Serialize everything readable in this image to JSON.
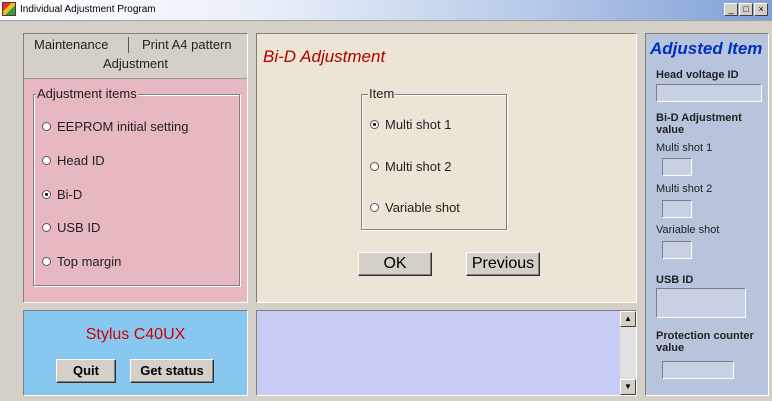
{
  "window": {
    "title": "Individual Adjustment Program",
    "controls": [
      "_",
      "□",
      "×"
    ]
  },
  "tabs": {
    "maintenance": "Maintenance",
    "print_a4": "Print A4 pattern",
    "adjustment": "Adjustment"
  },
  "adjustment_items": {
    "legend": "Adjustment items",
    "items": [
      {
        "label": "EEPROM initial setting",
        "selected": false
      },
      {
        "label": "Head ID",
        "selected": false
      },
      {
        "label": "Bi-D",
        "selected": true
      },
      {
        "label": "USB ID",
        "selected": false
      },
      {
        "label": "Top margin",
        "selected": false
      }
    ]
  },
  "bid": {
    "title": "Bi-D Adjustment",
    "item_legend": "Item",
    "items": [
      {
        "label": "Multi shot 1",
        "selected": true
      },
      {
        "label": "Multi shot 2",
        "selected": false
      },
      {
        "label": "Variable shot",
        "selected": false
      }
    ],
    "ok_label": "OK",
    "previous_label": "Previous"
  },
  "model": {
    "name": "Stylus C40UX",
    "quit_label": "Quit",
    "status_label": "Get status"
  },
  "adjusted": {
    "title": "Adjusted Item",
    "head_voltage_label": "Head voltage ID",
    "bid_value_label": "Bi-D Adjustment value",
    "multi1_label": "Multi shot 1",
    "multi2_label": "Multi shot 2",
    "variable_label": "Variable shot",
    "usb_label": "USB ID",
    "protection_label": "Protection counter value"
  },
  "colors": {
    "title_red": "#b00000",
    "model_red": "#d00000",
    "adjusted_blue": "#0030c0"
  }
}
